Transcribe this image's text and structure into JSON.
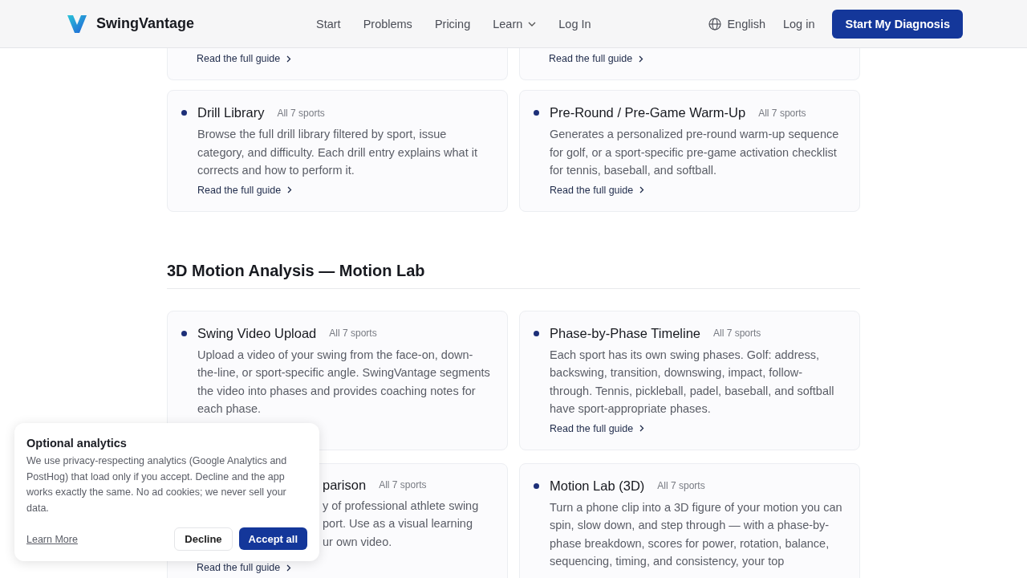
{
  "header": {
    "brand": "SwingVantage",
    "nav": [
      {
        "label": "Start",
        "kind": "link"
      },
      {
        "label": "Problems",
        "kind": "link"
      },
      {
        "label": "Pricing",
        "kind": "link"
      },
      {
        "label": "Learn",
        "kind": "menu"
      },
      {
        "label": "Log In",
        "kind": "link"
      }
    ],
    "language": "English",
    "login": "Log in",
    "cta": "Start My Diagnosis"
  },
  "sections": [
    {
      "cards": [
        {
          "kind": "cut",
          "link": "Read the full guide"
        },
        {
          "kind": "cut",
          "link": "Read the full guide"
        },
        {
          "kind": "full",
          "title": "Drill Library",
          "badge": "All 7 sports",
          "description": "Browse the full drill library filtered by sport, issue category, and difficulty. Each drill entry explains what it corrects and how to perform it.",
          "link": "Read the full guide"
        },
        {
          "kind": "full",
          "title": "Pre-Round / Pre-Game Warm-Up",
          "badge": "All 7 sports",
          "description": "Generates a personalized pre-round warm-up sequence for golf, or a sport-specific pre-game activation checklist for tennis, baseball, and softball.",
          "link": "Read the full guide"
        }
      ]
    },
    {
      "heading": "3D Motion Analysis — Motion Lab",
      "cards": [
        {
          "kind": "full",
          "title": "Swing Video Upload",
          "badge": "All 7 sports",
          "description": "Upload a video of your swing from the face-on, down-the-line, or sport-specific angle. SwingVantage segments the video into phases and provides coaching notes for each phase."
        },
        {
          "kind": "full",
          "title": "Phase-by-Phase Timeline",
          "badge": "All 7 sports",
          "description": "Each sport has its own swing phases. Golf: address, backswing, transition, downswing, impact, follow-through. Tennis, pickleball, padel, baseball, and softball have sport-appropriate phases.",
          "link": "Read the full guide"
        },
        {
          "kind": "covered",
          "title": "parison",
          "badge": "All 7 sports",
          "lines": [
            "y of professional athlete swing",
            "port. Use as a visual learning",
            "ur own video."
          ],
          "link": "Read the full guide"
        },
        {
          "kind": "full",
          "title": "Motion Lab (3D)",
          "badge": "All 7 sports",
          "description": "Turn a phone clip into a 3D figure of your motion you can spin, slow down, and step through — with a phase-by-phase breakdown, scores for power, rotation, balance, sequencing, timing, and consistency, your top"
        }
      ]
    }
  ],
  "consent": {
    "title": "Optional analytics",
    "text": "We use privacy-respecting analytics (Google Analytics and PostHog) that load only if you accept. Decline and the app works exactly the same. No ad cookies; we never sell your data.",
    "learn_more": "Learn More",
    "decline": "Decline",
    "accept": "Accept all"
  }
}
